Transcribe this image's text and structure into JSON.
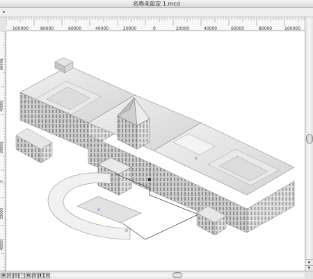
{
  "window": {
    "title": "名称未設定 1.mcd"
  },
  "ruler": {
    "horizontal_labels": [
      "100000",
      "80000",
      "60000",
      "40000",
      "20000",
      "0",
      "20000",
      "40000",
      "60000",
      "80000",
      "100000"
    ],
    "vertical_labels": [
      "60000",
      "40000",
      "20000",
      "0",
      "20000",
      "40000"
    ]
  },
  "toolbar": {
    "arrow_glyph": "▸"
  },
  "statusbar": {
    "buttons": [
      "▣",
      "▤",
      "▥",
      "□",
      "▦",
      "▧",
      "◧",
      "▨"
    ]
  },
  "scroll": {
    "up": "▲",
    "down": "▼"
  },
  "icons": {
    "toolbar_arrow": "triangle-right-icon",
    "scroll_thumb": "scroll-thumb-icon"
  }
}
